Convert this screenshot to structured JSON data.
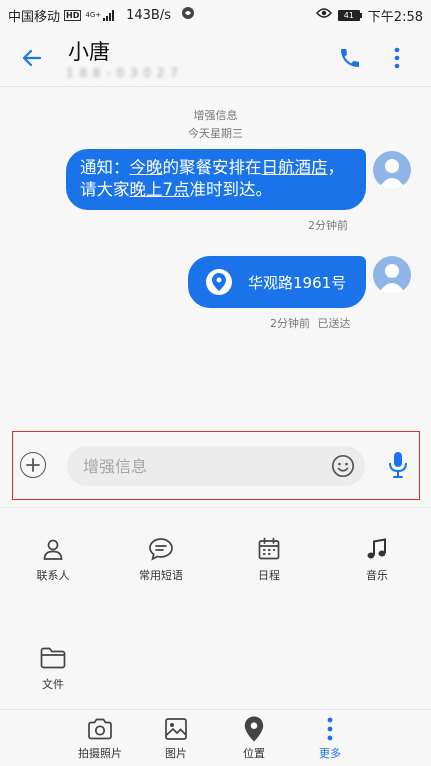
{
  "status_bar": {
    "carrier": "中国移动",
    "hd": "HD",
    "network": "4G+",
    "speed": "143B/s",
    "battery": "41",
    "time": "下午2:58"
  },
  "header": {
    "name": "小唐",
    "number": "1 8 8 - 0 3 0 2 7"
  },
  "conversation": {
    "label": "增强信息",
    "day": "今天星期三",
    "messages": [
      {
        "parts": [
          "通知：",
          "今晚",
          "的聚餐安排在",
          "日航酒店",
          "，请大家",
          "晚上7点",
          "准时到达。"
        ],
        "time": "2分钟前"
      },
      {
        "location": "华观路1961号",
        "time": "2分钟前",
        "status": "已送达"
      }
    ]
  },
  "composer": {
    "placeholder": "增强信息"
  },
  "attachments": [
    {
      "label": "联系人",
      "icon": "contact-icon"
    },
    {
      "label": "常用短语",
      "icon": "phrases-icon"
    },
    {
      "label": "日程",
      "icon": "calendar-icon"
    },
    {
      "label": "音乐",
      "icon": "music-icon"
    },
    {
      "label": "文件",
      "icon": "folder-icon"
    }
  ],
  "tabs": [
    {
      "label": "拍摄照片",
      "icon": "camera-icon"
    },
    {
      "label": "图片",
      "icon": "image-icon"
    },
    {
      "label": "位置",
      "icon": "location-icon"
    },
    {
      "label": "更多",
      "icon": "more-dots-icon",
      "active": true
    }
  ],
  "colors": {
    "accent": "#1a73e8",
    "highlight_border": "#e0302a",
    "background": "#f7f7f7"
  }
}
